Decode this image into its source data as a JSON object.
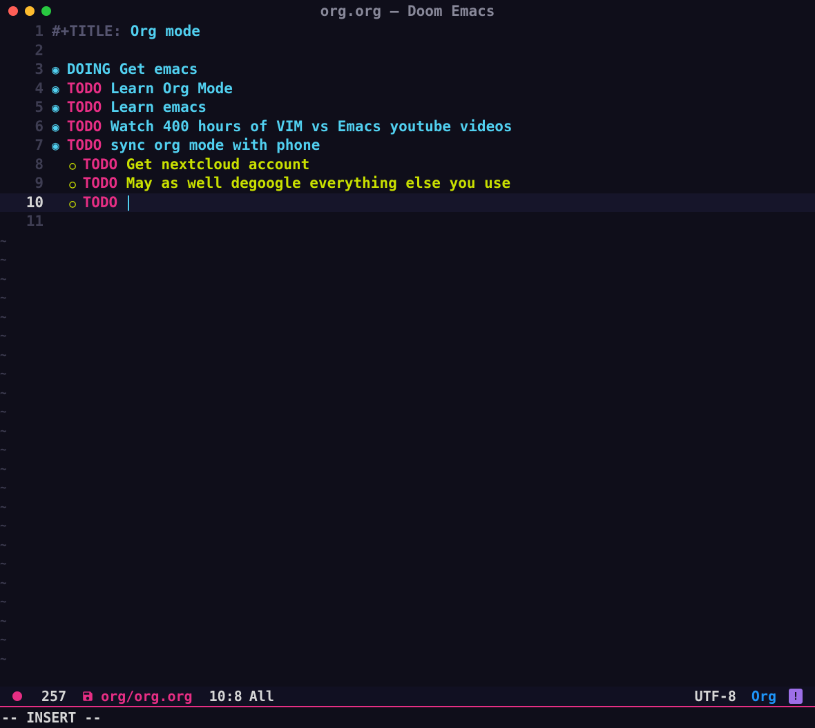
{
  "window": {
    "title": "org.org – Doom Emacs"
  },
  "buffer": {
    "title_keyword": "#+TITLE: ",
    "title_value": "Org mode",
    "lines": [
      {
        "num": "1"
      },
      {
        "num": "2"
      },
      {
        "num": "3",
        "state": "DOING",
        "text": "Get emacs"
      },
      {
        "num": "4",
        "state": "TODO",
        "text": "Learn Org Mode"
      },
      {
        "num": "5",
        "state": "TODO",
        "text": "Learn emacs"
      },
      {
        "num": "6",
        "state": "TODO",
        "text": "Watch 400 hours of VIM vs Emacs youtube videos"
      },
      {
        "num": "7",
        "state": "TODO",
        "text": "sync org mode with phone"
      },
      {
        "num": "8",
        "state": "TODO",
        "text": "Get nextcloud account"
      },
      {
        "num": "9",
        "state": "TODO",
        "text": "May as well degoogle everything else you use"
      },
      {
        "num": "10",
        "state": "TODO",
        "text": ""
      },
      {
        "num": "11"
      }
    ]
  },
  "modeline": {
    "filesize": "257",
    "filepath": "org/org.org",
    "cursor_position": "10:8",
    "buffer_view": "All",
    "encoding": "UTF-8",
    "major_mode": "Org",
    "flycheck_indicator": "!"
  },
  "echo": {
    "text": "-- INSERT --"
  }
}
